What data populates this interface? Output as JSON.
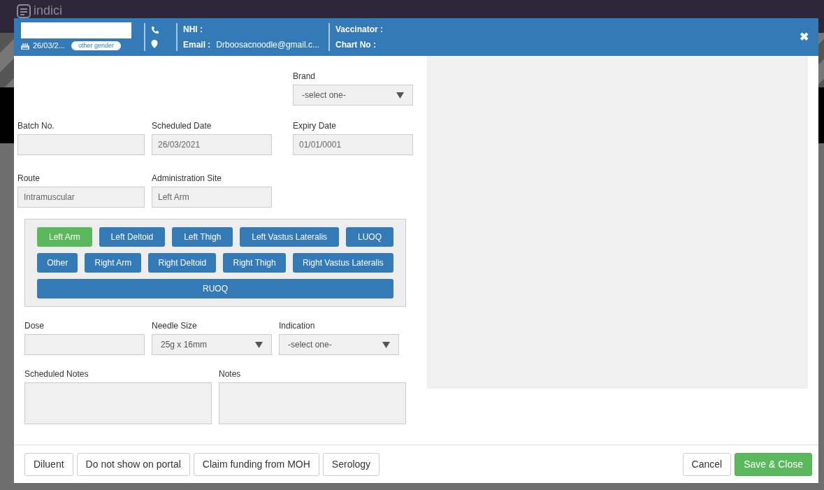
{
  "background": {
    "logo": "indici"
  },
  "header": {
    "dob": "26/03/2...",
    "gender": "other gender",
    "nhi_label": "NHI :",
    "email_label": "Email :",
    "email": "Drboosacnoodle@gmail.c...",
    "vaccinator_label": "Vaccinator :",
    "chart_label": "Chart No :",
    "close": "✖"
  },
  "form": {
    "brand": {
      "label": "Brand",
      "kind": "select",
      "value": "-select one-"
    },
    "batch_no": {
      "label": "Batch No.",
      "kind": "input"
    },
    "scheduled_date": {
      "label": "Scheduled Date",
      "kind": "input",
      "value": "26/03/2021"
    },
    "expiry_date": {
      "label": "Expiry Date",
      "kind": "input",
      "value": "01/01/0001"
    },
    "route": {
      "label": "Route",
      "kind": "input",
      "value": "Intramuscular"
    },
    "administration_site": {
      "label": "Administration Site",
      "kind": "input",
      "value": "Left Arm"
    },
    "dose": {
      "label": "Dose",
      "kind": "input"
    },
    "needle_size": {
      "label": "Needle Size",
      "kind": "select",
      "value": "25g x 16mm"
    },
    "indication": {
      "label": "Indication",
      "kind": "select",
      "value": "-select one-"
    },
    "scheduled_notes": {
      "label": "Scheduled Notes",
      "kind": "textarea"
    },
    "notes": {
      "label": "Notes",
      "kind": "textarea"
    }
  },
  "site_buttons": [
    [
      {
        "label": "Left Arm",
        "selected": true
      },
      {
        "label": "Left Deltoid",
        "selected": false
      },
      {
        "label": "Left Thigh",
        "selected": false
      },
      {
        "label": "Left Vastus Lateralis",
        "selected": false
      },
      {
        "label": "LUOQ",
        "selected": false
      }
    ],
    [
      {
        "label": "Other",
        "selected": false
      },
      {
        "label": "Right Arm",
        "selected": false
      },
      {
        "label": "Right Deltoid",
        "selected": false
      },
      {
        "label": "Right Thigh",
        "selected": false
      },
      {
        "label": "Right Vastus Lateralis",
        "selected": false
      }
    ],
    [
      {
        "label": "RUOQ",
        "selected": false
      }
    ]
  ],
  "footer": {
    "left": [
      "Diluent",
      "Do not show on portal",
      "Claim funding from MOH",
      "Serology"
    ],
    "right": [
      {
        "label": "Cancel",
        "kind": "default"
      },
      {
        "label": "Save & Close",
        "kind": "primary"
      }
    ]
  }
}
